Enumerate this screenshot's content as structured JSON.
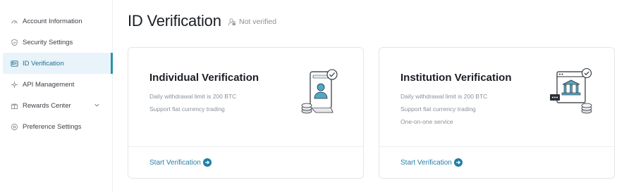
{
  "sidebar": {
    "items": [
      {
        "label": "Account Information",
        "icon": "gauge-icon"
      },
      {
        "label": "Security Settings",
        "icon": "shield-icon"
      },
      {
        "label": "ID Verification",
        "icon": "id-card-icon",
        "active": true
      },
      {
        "label": "API Management",
        "icon": "api-icon"
      },
      {
        "label": "Rewards Center",
        "icon": "gift-icon",
        "has_dropdown": true
      },
      {
        "label": "Preference Settings",
        "icon": "settings-icon"
      }
    ]
  },
  "header": {
    "title": "ID Verification",
    "status": "Not verified",
    "status_icon": "user-lock-icon"
  },
  "cards": [
    {
      "title": "Individual Verification",
      "features": [
        "Daily withdrawal limit is 200 BTC",
        "Support fiat currency trading"
      ],
      "action": "Start Verification",
      "illustration": "individual-verification-illustration"
    },
    {
      "title": "Institution Verification",
      "features": [
        "Daily withdrawal limit is 200 BTC",
        "Support fiat currency trading",
        "One-on-one service"
      ],
      "action": "Start Verification",
      "illustration": "institution-verification-illustration"
    }
  ],
  "colors": {
    "accent": "#2a8fb0",
    "link": "#2a7fa8",
    "active_bg": "#e9f3fa",
    "illustration_teal": "#4fa9c6"
  }
}
